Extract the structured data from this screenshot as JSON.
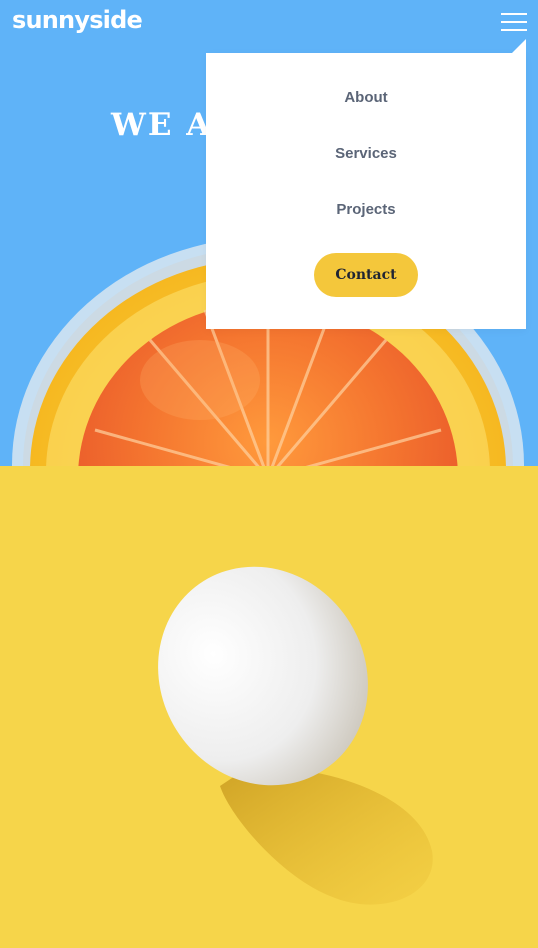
{
  "header": {
    "logo": "sunnyside",
    "menu_icon": "hamburger-icon"
  },
  "hero": {
    "title_visible": "WE AR"
  },
  "menu": {
    "items": [
      {
        "label": "About"
      },
      {
        "label": "Services"
      },
      {
        "label": "Projects"
      }
    ],
    "contact_label": "Contact"
  },
  "colors": {
    "sky": "#5fb3f8",
    "egg_background": "#f6d54a",
    "contact_button": "#f4c73b",
    "menu_text": "#5b6577",
    "white": "#ffffff"
  }
}
